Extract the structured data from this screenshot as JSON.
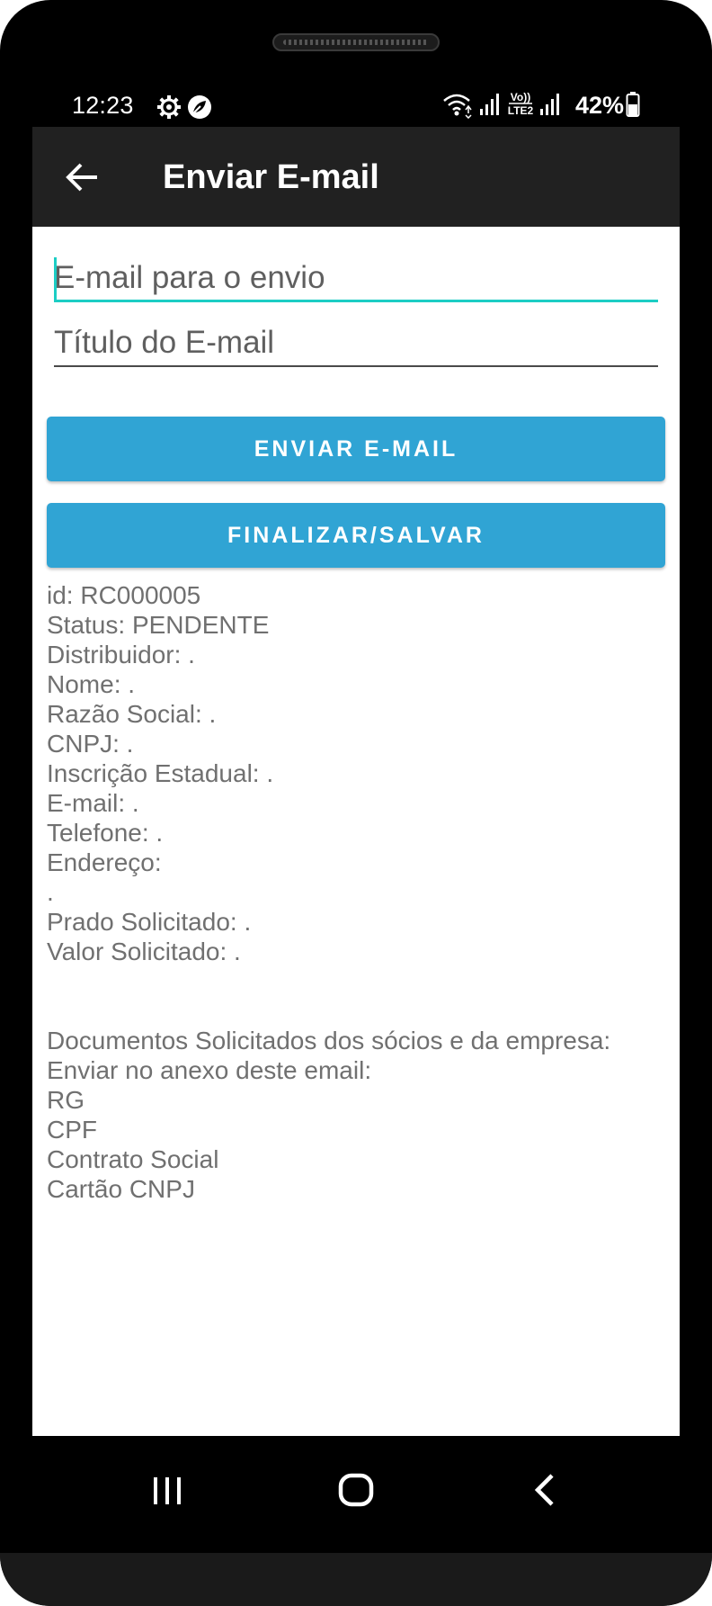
{
  "status_bar": {
    "time": "12:23",
    "battery": "42%"
  },
  "app_bar": {
    "title": "Enviar E-mail"
  },
  "form": {
    "email_placeholder": "E-mail para o envio",
    "email_value": "",
    "subject_placeholder": "Título do E-mail",
    "subject_value": "",
    "send_button": "ENVIAR E-MAIL",
    "finish_button": "FINALIZAR/SALVAR"
  },
  "details": [
    "id: RC000005",
    "Status: PENDENTE",
    "Distribuidor: .",
    "Nome: .",
    "Razão Social: .",
    "CNPJ: .",
    "Inscrição Estadual: .",
    "E-mail: .",
    "Telefone: .",
    "Endereço:",
    ".",
    "Prado Solicitado: .",
    "Valor Solicitado: .",
    "",
    "",
    "Documentos Solicitados dos sócios e da empresa:",
    "Enviar no anexo deste email:",
    "RG",
    "CPF",
    "Contrato Social",
    "Cartão CNPJ"
  ],
  "icons": {
    "settings": "gear-icon",
    "app_notification": "leaf-icon",
    "wifi": "wifi-icon",
    "signal": "signal-icon",
    "volte": "volte-lte2-icon",
    "battery": "battery-icon",
    "back": "arrow-left-icon",
    "recents": "recents-icon",
    "home": "home-icon",
    "nav_back": "chevron-left-icon"
  },
  "colors": {
    "app_bar": "#212121",
    "button": "#30a4d4",
    "focus_accent": "#1ccdc4",
    "detail_text": "#707070"
  }
}
